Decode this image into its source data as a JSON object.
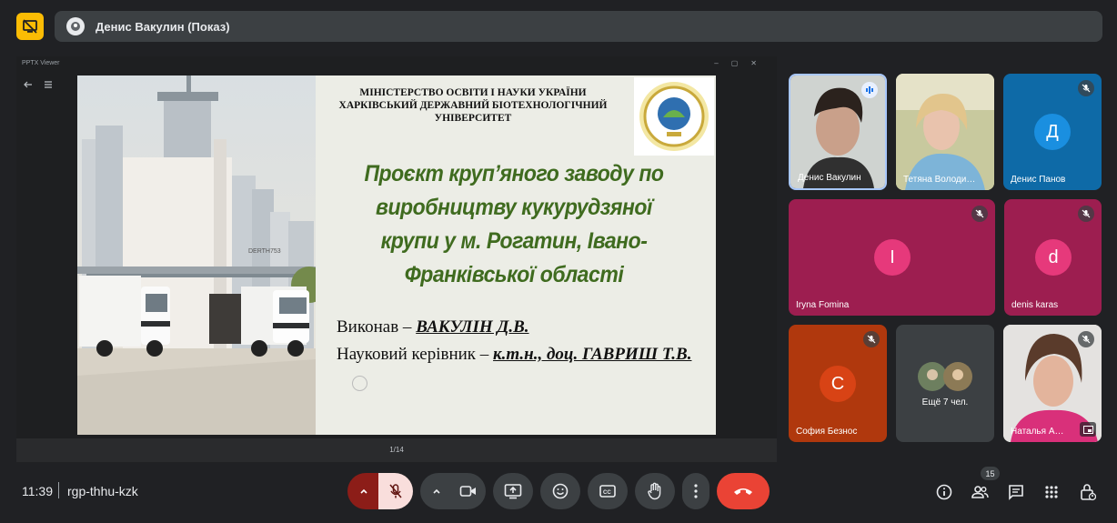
{
  "presenter": {
    "name": "Денис Вакулин (Показ)"
  },
  "viewer": {
    "title": "PPTX Viewer",
    "page": "1/14"
  },
  "slide": {
    "ministry_lines": [
      "МІНІСТЕРСТВО ОСВІТИ І НАУКИ УКРАЇНИ",
      "ХАРКІВСЬКИЙ ДЕРЖАВНИЙ БІОТЕХНОЛОГІЧНИЙ",
      "УНІВЕРСИТЕТ"
    ],
    "title_lines": [
      "Проєкт круп’яного заводу по",
      "виробництву кукурудзяної",
      "крупи у м. Рогатин, Івано-",
      "Франківської області"
    ],
    "author_label": "Виконав – ",
    "author_name": "ВАКУЛІН Д.В.",
    "supervisor_label": "Науковий керівник – ",
    "supervisor_name": "к.т.н., доц. ГАВРИШ Т.В.",
    "truck_text": "DERTH753"
  },
  "participants": [
    {
      "name": "Денис Вакулин",
      "type": "video",
      "speaking": true
    },
    {
      "name": "Тетяна Володи…",
      "type": "video"
    },
    {
      "name": "Денис Панов",
      "initial": "Д",
      "muted": true
    },
    {
      "name": "Iryna Fomina",
      "initial": "I",
      "muted": true
    },
    {
      "name": "denis karas",
      "initial": "d",
      "muted": true
    },
    {
      "name": "София Безнос",
      "initial": "С",
      "muted": true
    },
    {
      "name": "Ещё 7 чел.",
      "type": "more"
    },
    {
      "name": "Наталья А…",
      "type": "video",
      "muted": true
    }
  ],
  "colors": {
    "accent": "#fbbc04",
    "hangup": "#ea4335",
    "mic_off": "#f9dedc",
    "tile_pink": "#9d1e50",
    "tile_blue": "#0e6aa7",
    "tile_orange": "#b0380d"
  },
  "meeting": {
    "time": "11:39",
    "code": "rgp-thhu-kzk",
    "participant_count": "15"
  }
}
